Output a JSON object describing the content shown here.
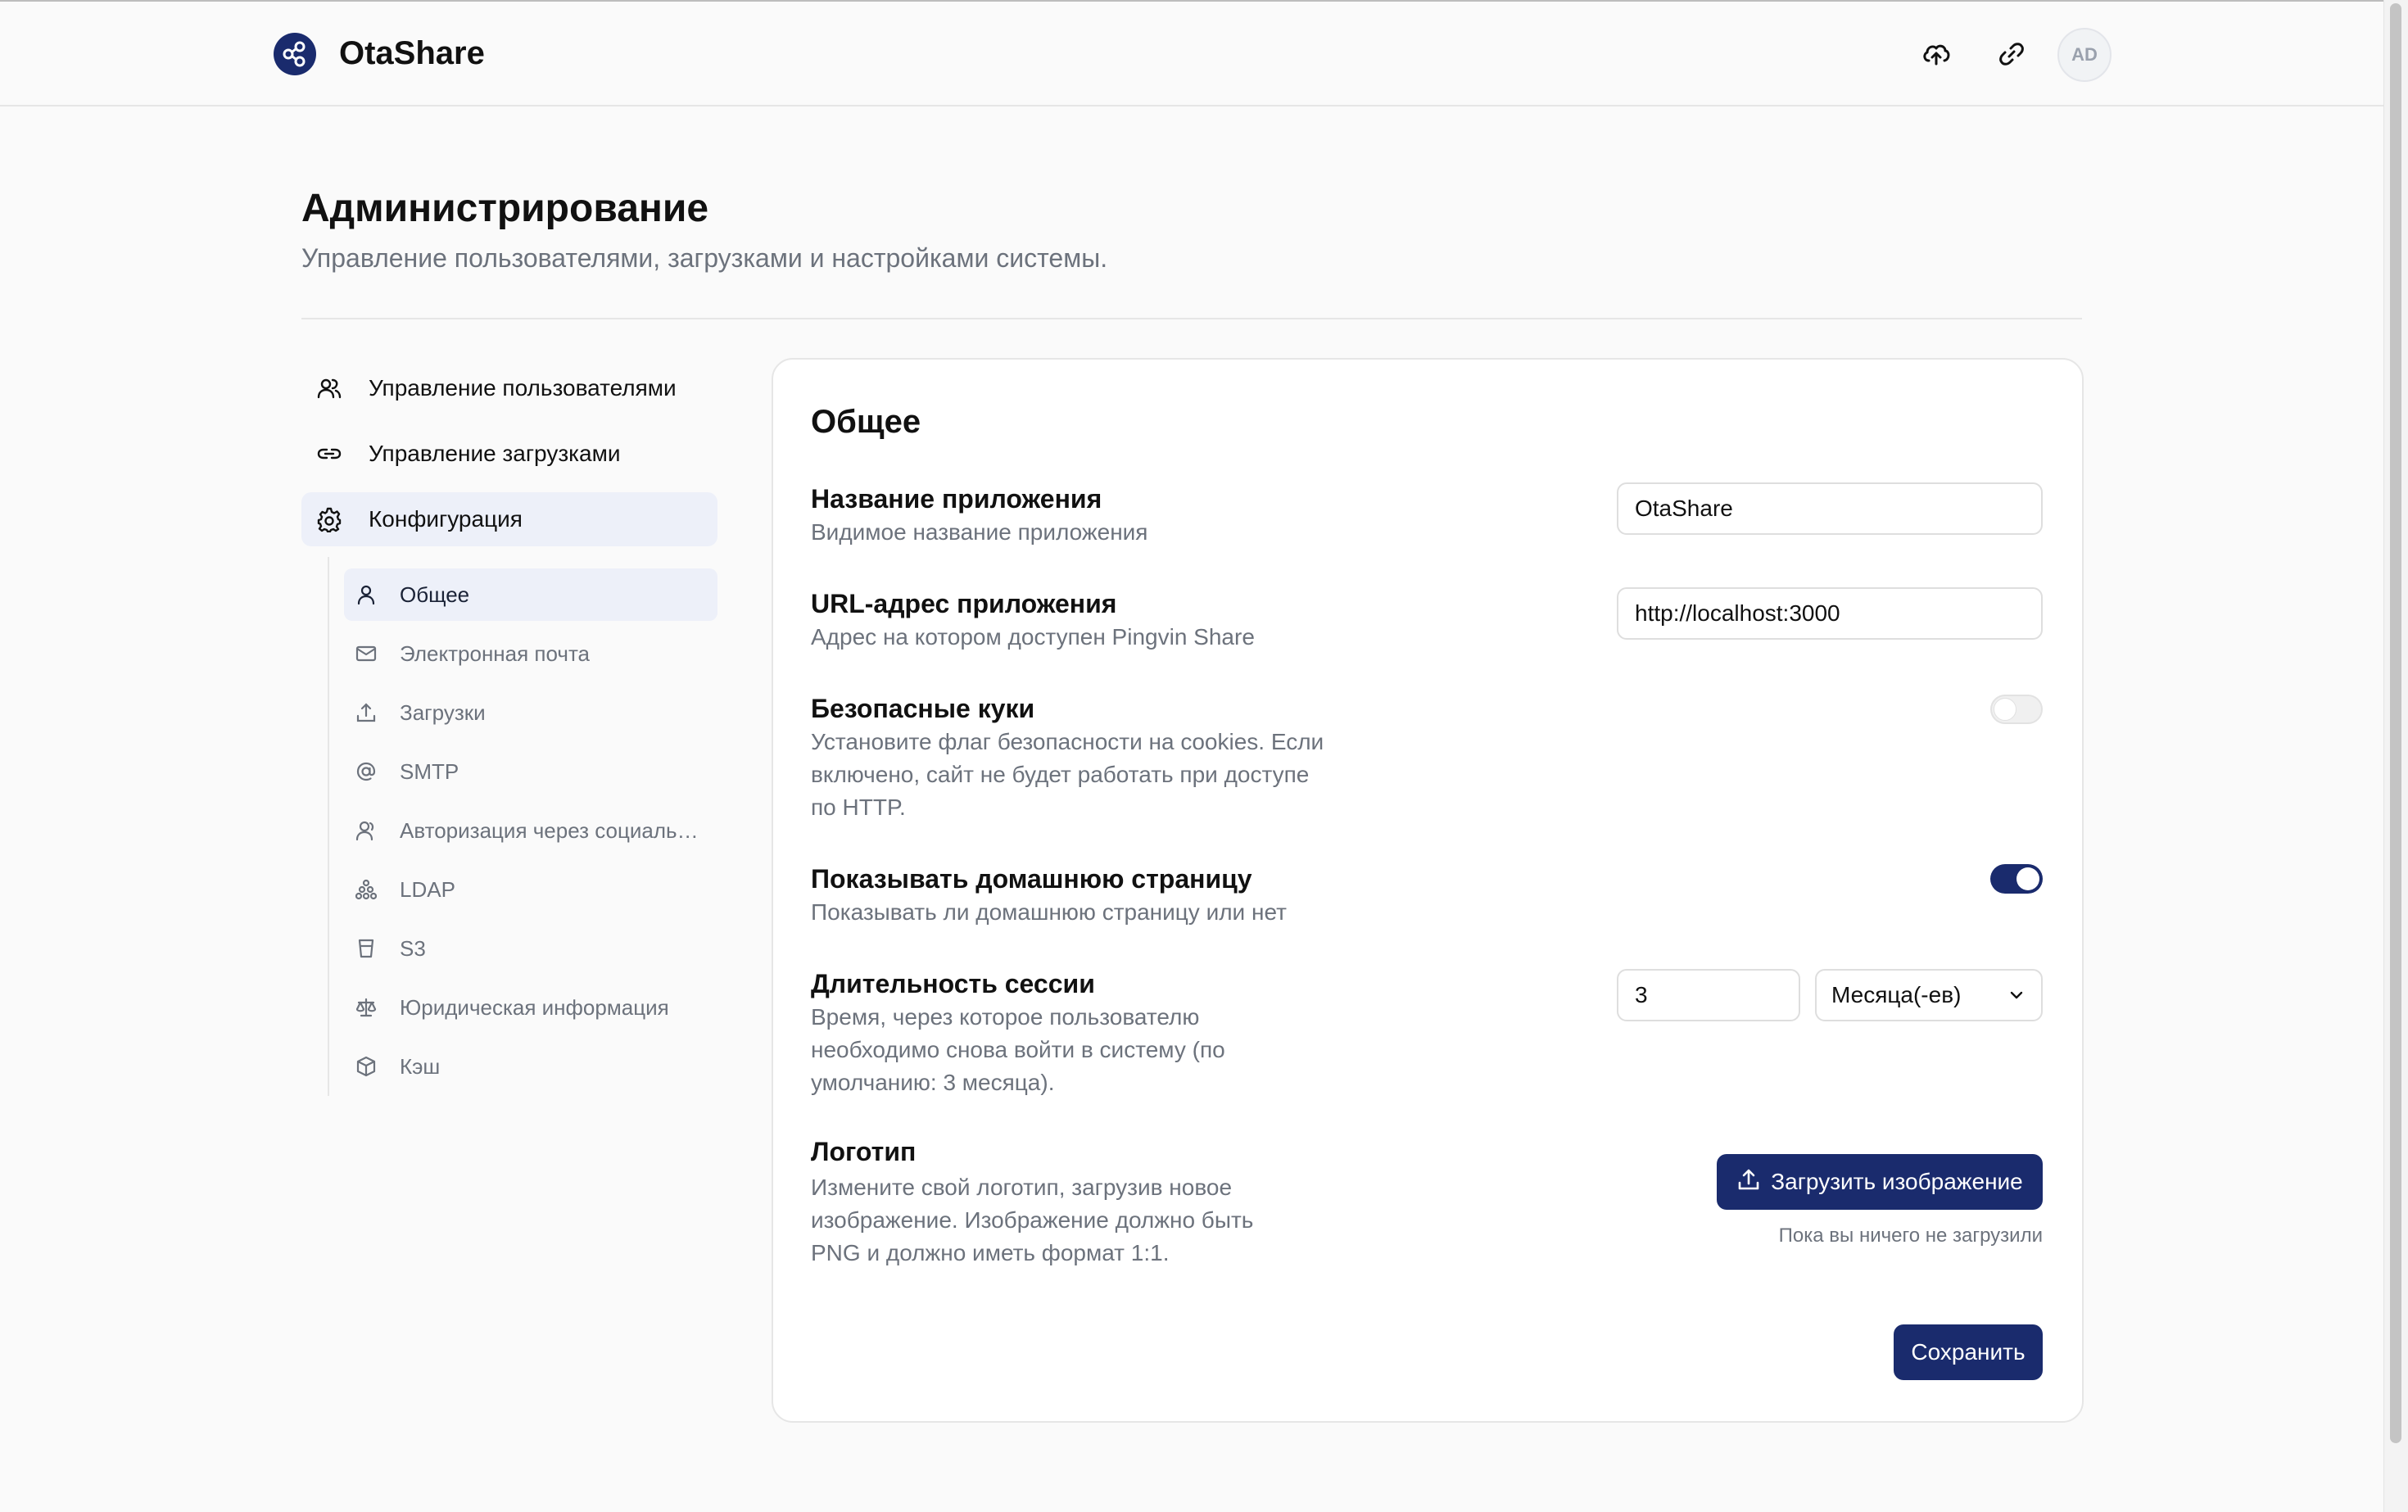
{
  "app": {
    "name": "OtaShare",
    "avatar_initials": "AD"
  },
  "header": {
    "icons": [
      "share-logo-icon",
      "cloud-upload-icon",
      "link-icon"
    ]
  },
  "page": {
    "title": "Администрирование",
    "subtitle": "Управление пользователями, загрузками и настройками системы."
  },
  "sidebar": {
    "items": [
      {
        "label": "Управление пользователями",
        "icon": "users-icon"
      },
      {
        "label": "Управление загрузками",
        "icon": "link-icon"
      },
      {
        "label": "Конфигурация",
        "icon": "gear-icon",
        "active": true
      }
    ],
    "subitems": [
      {
        "label": "Общее",
        "icon": "user-icon",
        "active": true
      },
      {
        "label": "Электронная почта",
        "icon": "mail-icon"
      },
      {
        "label": "Загрузки",
        "icon": "upload-icon"
      },
      {
        "label": "SMTP",
        "icon": "at-icon"
      },
      {
        "label": "Авторизация через социальные сети",
        "icon": "user-icon"
      },
      {
        "label": "LDAP",
        "icon": "hierarchy-icon"
      },
      {
        "label": "S3",
        "icon": "bucket-icon"
      },
      {
        "label": "Юридическая информация",
        "icon": "scale-icon"
      },
      {
        "label": "Кэш",
        "icon": "box-icon"
      }
    ]
  },
  "settings": {
    "section_title": "Общее",
    "app_name": {
      "label": "Название приложения",
      "description": "Видимое название приложения",
      "value": "OtaShare"
    },
    "app_url": {
      "label": "URL-адрес приложения",
      "description": "Адрес на котором доступен Pingvin Share",
      "value": "http://localhost:3000"
    },
    "secure_cookies": {
      "label": "Безопасные куки",
      "description": "Установите флаг безопасности на cookies. Если включено, сайт не будет работать при доступе по HTTP.",
      "enabled": false
    },
    "show_home_page": {
      "label": "Показывать домашнюю страницу",
      "description": "Показывать ли домашнюю страницу или нет",
      "enabled": true
    },
    "session_duration": {
      "label": "Длительность сессии",
      "description": "Время, через которое пользователю необходимо снова войти в систему (по умолчанию: 3 месяца).",
      "value": "3",
      "unit": "Месяца(-ев)"
    },
    "logo": {
      "label": "Логотип",
      "description": "Измените свой логотип, загрузив новое изображение. Изображение должно быть PNG и должно иметь формат 1:1.",
      "upload_label": "Загрузить изображение",
      "hint": "Пока вы ничего не загрузили"
    },
    "save_label": "Сохранить"
  },
  "colors": {
    "accent": "#1a2b6d",
    "muted_text": "#6c727c",
    "active_nav_bg": "#edf0f9"
  }
}
